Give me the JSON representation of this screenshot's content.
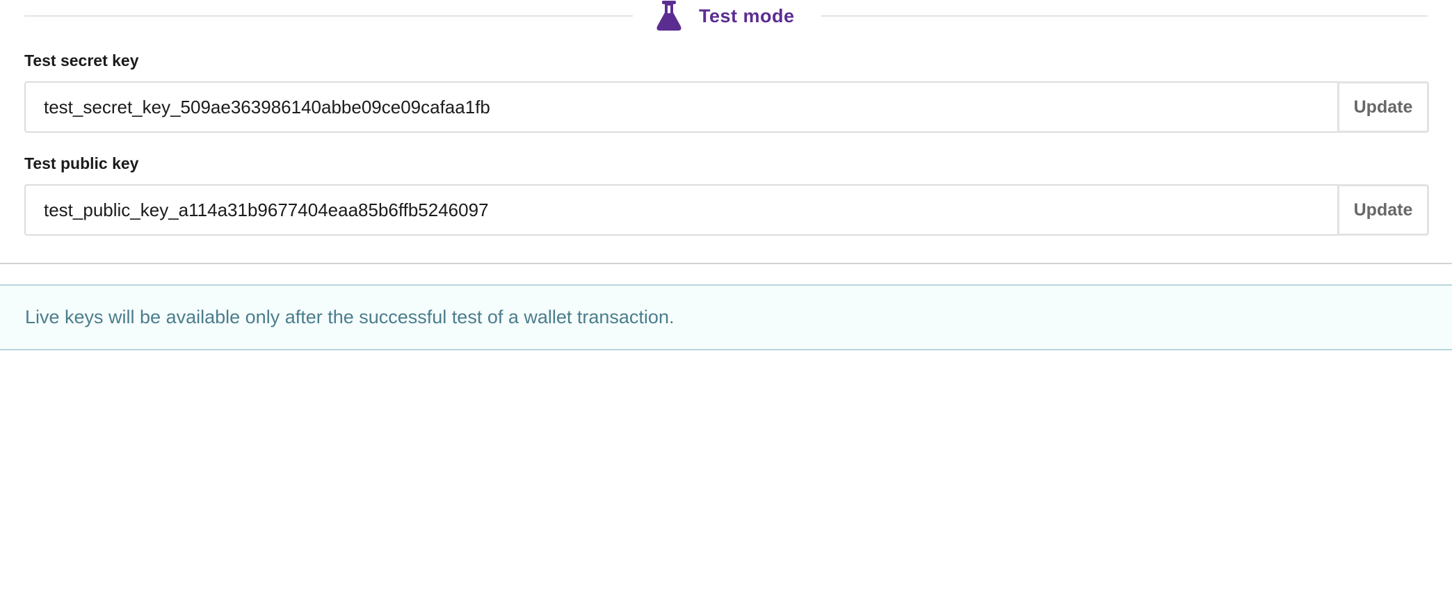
{
  "section": {
    "title": "Test mode",
    "icon": "flask-icon",
    "accent_color": "#5c2d91"
  },
  "secret_key": {
    "label": "Test secret key",
    "value": "test_secret_key_509ae363986140abbe09ce09cafaa1fb",
    "button_label": "Update"
  },
  "public_key": {
    "label": "Test public key",
    "value": "test_public_key_a114a31b9677404eaa85b6ffb5246097",
    "button_label": "Update"
  },
  "alert": {
    "message": "Live keys will be available only after the successful test of a wallet transaction.",
    "background_color": "#f6fdfd",
    "text_color": "#4a7d8c"
  }
}
